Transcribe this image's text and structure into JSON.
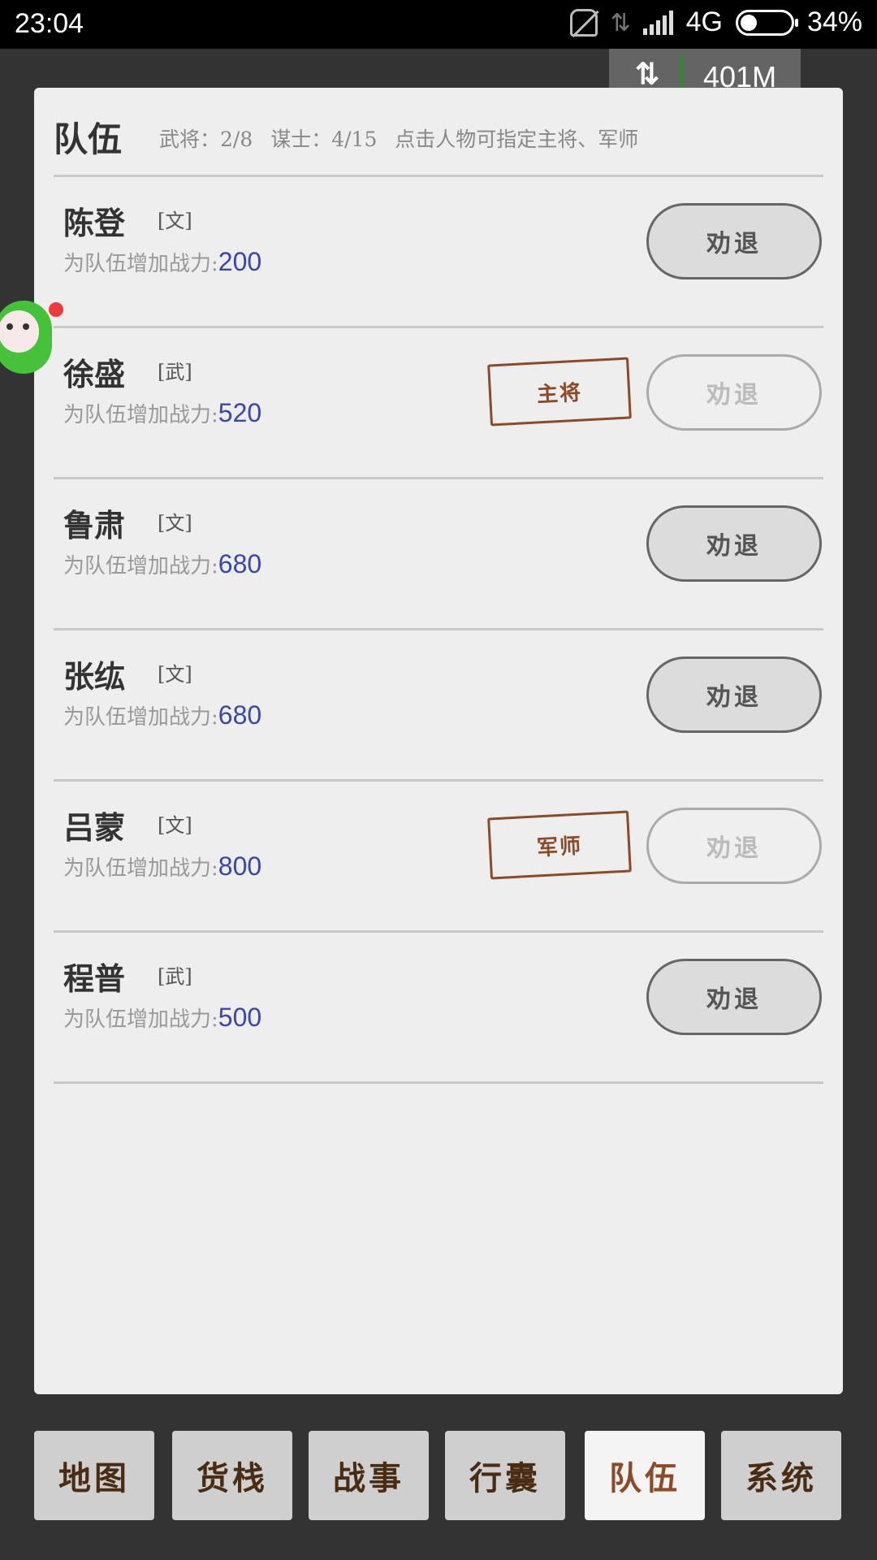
{
  "status_bar": {
    "time": "23:04",
    "network": "4G",
    "battery": "34%"
  },
  "memory_badge": {
    "value": "401M"
  },
  "panel": {
    "title": "队伍",
    "generals": "武将：2/8",
    "advisors": "谋士：4/15",
    "hint": "点击人物可指定主将、军师"
  },
  "power_label": "为队伍增加战力:",
  "dismiss_label": "劝退",
  "members": [
    {
      "name": "陈登",
      "tag": "[文]",
      "power": "200",
      "badge": "",
      "dismiss_disabled": false
    },
    {
      "name": "徐盛",
      "tag": "[武]",
      "power": "520",
      "badge": "主将",
      "dismiss_disabled": true
    },
    {
      "name": "鲁肃",
      "tag": "[文]",
      "power": "680",
      "badge": "",
      "dismiss_disabled": false
    },
    {
      "name": "张纮",
      "tag": "[文]",
      "power": "680",
      "badge": "",
      "dismiss_disabled": false
    },
    {
      "name": "吕蒙",
      "tag": "[文]",
      "power": "800",
      "badge": "军师",
      "dismiss_disabled": true
    },
    {
      "name": "程普",
      "tag": "[武]",
      "power": "500",
      "badge": "",
      "dismiss_disabled": false
    }
  ],
  "nav": [
    {
      "label": "地图"
    },
    {
      "label": "货栈"
    },
    {
      "label": "战事"
    },
    {
      "label": "行囊"
    },
    {
      "label": "队伍",
      "active": true
    },
    {
      "label": "系统"
    }
  ]
}
